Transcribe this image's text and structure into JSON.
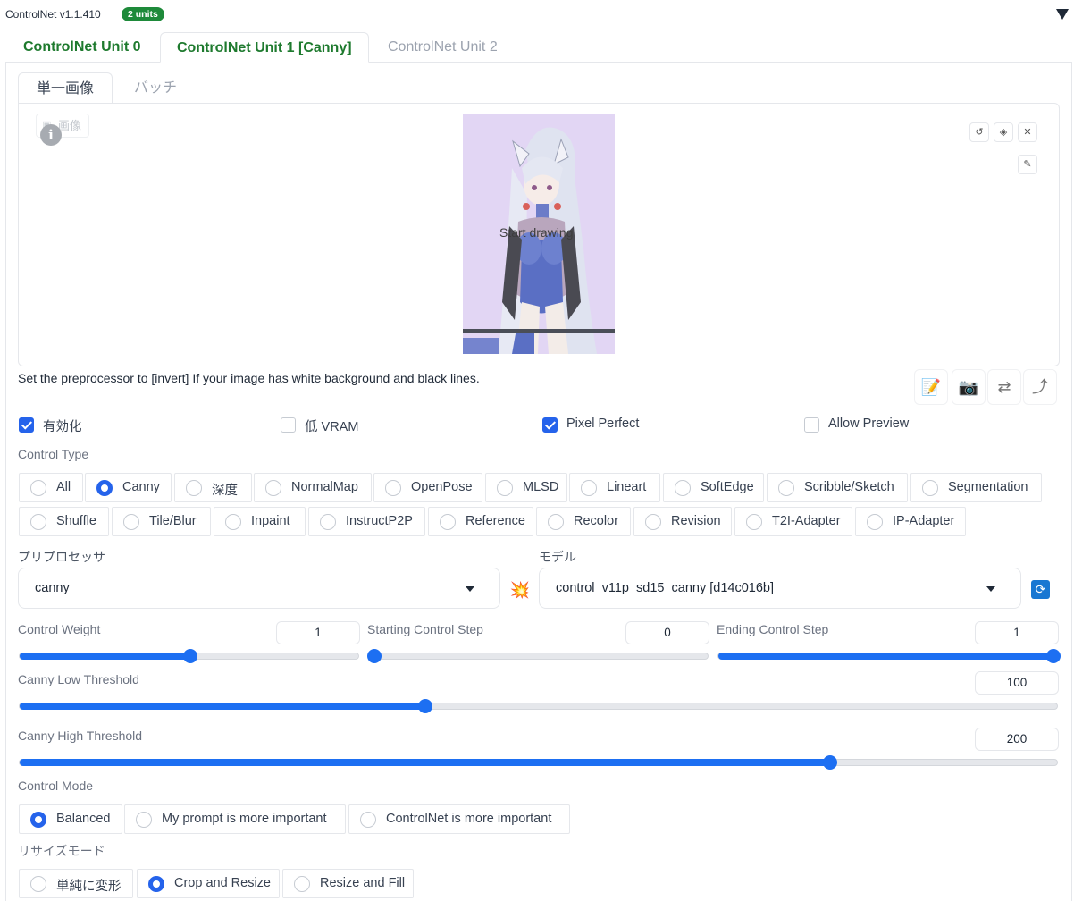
{
  "header": {
    "title": "ControlNet v1.1.410",
    "badge": "2 units"
  },
  "unit_tabs": [
    {
      "label": "ControlNet Unit 0",
      "state": "normal"
    },
    {
      "label": "ControlNet Unit 1 [Canny]",
      "state": "active"
    },
    {
      "label": "ControlNet Unit 2",
      "state": "inactive"
    }
  ],
  "image_tabs": [
    {
      "label": "単一画像",
      "state": "active"
    },
    {
      "label": "バッチ",
      "state": "inactive"
    }
  ],
  "canvas": {
    "image_label": "画像",
    "overlay_text": "Start drawing"
  },
  "hint": "Set the preprocessor to [invert] If your image has white background and black lines.",
  "toggles": [
    {
      "label": "有効化",
      "checked": true
    },
    {
      "label": "低 VRAM",
      "checked": false
    },
    {
      "label": "Pixel Perfect",
      "checked": true
    },
    {
      "label": "Allow Preview",
      "checked": false
    }
  ],
  "control_type": {
    "label": "Control Type",
    "selected": "Canny",
    "options_row1": [
      "All",
      "Canny",
      "深度",
      "NormalMap",
      "OpenPose",
      "MLSD",
      "Lineart",
      "SoftEdge",
      "Scribble/Sketch",
      "Segmentation"
    ],
    "options_row2": [
      "Shuffle",
      "Tile/Blur",
      "Inpaint",
      "InstructP2P",
      "Reference",
      "Recolor",
      "Revision",
      "T2I-Adapter",
      "IP-Adapter"
    ]
  },
  "preprocessor": {
    "label": "プリプロセッサ",
    "value": "canny"
  },
  "model": {
    "label": "モデル",
    "value": "control_v11p_sd15_canny [d14c016b]"
  },
  "sliders": {
    "control_weight": {
      "label": "Control Weight",
      "value": "1",
      "min": 0,
      "max": 2,
      "fraction": 0.5
    },
    "starting_step": {
      "label": "Starting Control Step",
      "value": "0",
      "min": 0,
      "max": 1,
      "fraction": 0
    },
    "ending_step": {
      "label": "Ending Control Step",
      "value": "1",
      "min": 0,
      "max": 1,
      "fraction": 1
    },
    "canny_low": {
      "label": "Canny Low Threshold",
      "value": "100",
      "min": 1,
      "max": 255,
      "fraction": 0.39
    },
    "canny_high": {
      "label": "Canny High Threshold",
      "value": "200",
      "min": 1,
      "max": 255,
      "fraction": 0.78
    }
  },
  "control_mode": {
    "label": "Control Mode",
    "selected": "Balanced",
    "options": [
      "Balanced",
      "My prompt is more important",
      "ControlNet is more important"
    ]
  },
  "resize_mode": {
    "label": "リサイズモード",
    "selected": "Crop and Resize",
    "options": [
      "単純に変形",
      "Crop and Resize",
      "Resize and Fill"
    ]
  },
  "colors": {
    "accent": "#2563eb",
    "slider": "#1d6ff2",
    "tab_green": "#1e7a2e",
    "badge_green": "#1e8a3a"
  }
}
